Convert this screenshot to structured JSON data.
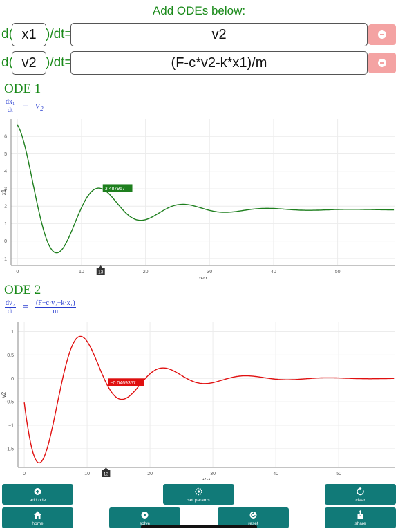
{
  "header": {
    "title": "Add ODEs below:"
  },
  "odes": [
    {
      "d_prefix": "d(",
      "var": "x1",
      "dt_suffix": ")/dt=",
      "expr": "v2"
    },
    {
      "d_prefix": "d(",
      "var": "v2",
      "dt_suffix": ")/dt=",
      "expr": "(F-c*v2-k*x1)/m"
    }
  ],
  "panels": [
    {
      "title": "ODE 1",
      "equation": {
        "num": "dx₁",
        "den": "dt",
        "eq": "=",
        "rhs": "v₂"
      }
    },
    {
      "title": "ODE 2",
      "equation": {
        "num": "dv₂",
        "den": "dt",
        "eq": "=",
        "rhs_num": "(F−c·v₂−k·x₁)",
        "rhs_den": "m"
      }
    }
  ],
  "chart_data": [
    {
      "type": "line",
      "xlabel": "t(s)",
      "ylabel": "x1",
      "xlim": [
        -1,
        59
      ],
      "ylim": [
        -1.4,
        7.0
      ],
      "xticks": [
        0,
        10,
        20,
        30,
        40,
        50
      ],
      "yticks": [
        -1,
        0,
        1,
        2,
        3,
        4,
        5,
        6
      ],
      "ytick_labels": [
        "−1",
        "0",
        "1",
        "2",
        "3",
        "4",
        "5",
        "6"
      ],
      "grid": true,
      "color": "#1e7f1e",
      "model": {
        "steady": 1.8,
        "amp": 4.85,
        "decay": 0.106,
        "omega": 0.478,
        "phase": 0.0
      },
      "x_end": 59,
      "cursor": {
        "x": 13,
        "x_label": "13",
        "value_label": "3.487957"
      }
    },
    {
      "type": "line",
      "xlabel": "t(s)",
      "ylabel": "v2",
      "xlim": [
        -1,
        59
      ],
      "ylim": [
        -1.9,
        1.2
      ],
      "xticks": [
        0,
        10,
        20,
        30,
        40,
        50
      ],
      "yticks": [
        -1.5,
        -1,
        -0.5,
        0,
        0.5,
        1
      ],
      "ytick_labels": [
        "−1.5",
        "−1",
        "−0.5",
        "0",
        "0.5",
        "1"
      ],
      "grid": true,
      "color": "#e01010",
      "model": {
        "steady": 0.0,
        "amp": 2.32,
        "decay": 0.106,
        "omega": 0.478,
        "phase": 0.0,
        "derivative": true
      },
      "x_end": 59,
      "cursor": {
        "x": 13,
        "x_label": "13",
        "value_label": "−0.0469357"
      }
    }
  ],
  "buttons": [
    {
      "label": "add ode",
      "icon": "plus-circle-icon"
    },
    {
      "label": "set params",
      "icon": "gear-icon"
    },
    {
      "label": "clear",
      "icon": "refresh-icon"
    },
    {
      "label": "home",
      "icon": "home-icon"
    },
    {
      "label": "solve",
      "icon": "play-icon"
    },
    {
      "label": "reset",
      "icon": "reset-icon"
    },
    {
      "label": "share",
      "icon": "share-icon"
    }
  ]
}
